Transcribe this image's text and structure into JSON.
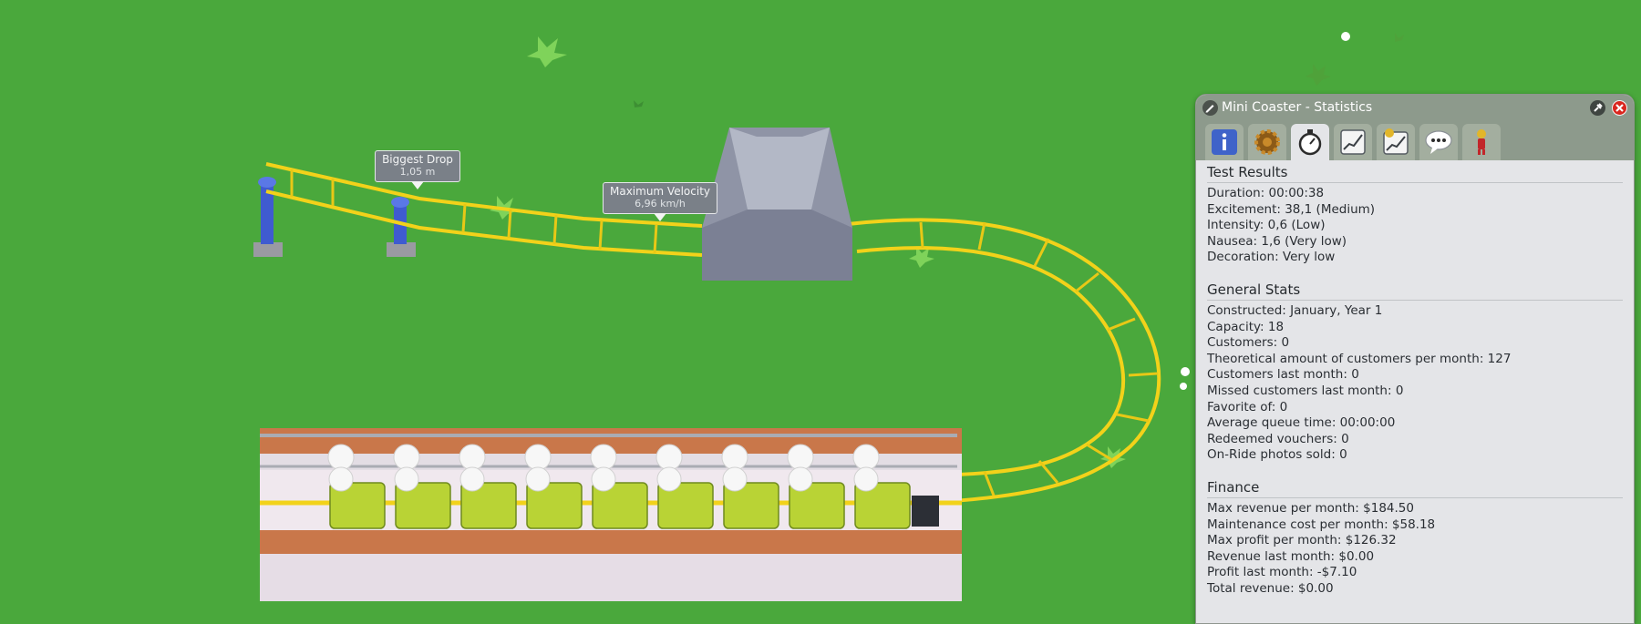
{
  "window": {
    "title": "Mini Coaster - Statistics",
    "icons": {
      "edit": "pencil-icon",
      "pin": "pin-icon",
      "close": "close-icon"
    }
  },
  "tabs": [
    {
      "name": "info-icon"
    },
    {
      "name": "gear-icon"
    },
    {
      "name": "stopwatch-icon",
      "active": true
    },
    {
      "name": "graph-icon"
    },
    {
      "name": "finance-graph-icon"
    },
    {
      "name": "speech-bubble-icon"
    },
    {
      "name": "guest-icon"
    }
  ],
  "test_results": {
    "title": "Test Results",
    "rows": [
      "Duration: 00:00:38",
      "Excitement: 38,1 (Medium)",
      "Intensity: 0,6 (Low)",
      "Nausea: 1,6 (Very low)",
      "Decoration: Very low"
    ]
  },
  "general_stats": {
    "title": "General Stats",
    "rows": [
      "Constructed: January, Year 1",
      "Capacity: 18",
      "Customers: 0",
      "Theoretical amount of customers per month: 127",
      "Customers last month: 0",
      "Missed customers last month: 0",
      "Favorite of: 0",
      "Average queue time: 00:00:00",
      "Redeemed vouchers: 0",
      "On-Ride photos sold: 0"
    ]
  },
  "finance": {
    "title": "Finance",
    "rows": [
      "Max revenue per month: $184.50",
      "Maintenance cost per month: $58.18",
      "Max profit per month: $126.32",
      "Revenue last month: $0.00",
      "Profit last month: -$7.10",
      "Total revenue: $0.00"
    ]
  },
  "markers": {
    "biggest_drop": {
      "label": "Biggest Drop",
      "value": "1,05 m"
    },
    "max_velocity": {
      "label": "Maximum Velocity",
      "value": "6,96 km/h"
    }
  },
  "colors": {
    "grass": "#4aa83c",
    "track": "#f2d21a",
    "panel_bg": "#e4e5e8",
    "panel_header": "#8d9a8c",
    "close_button": "#d9261e"
  }
}
